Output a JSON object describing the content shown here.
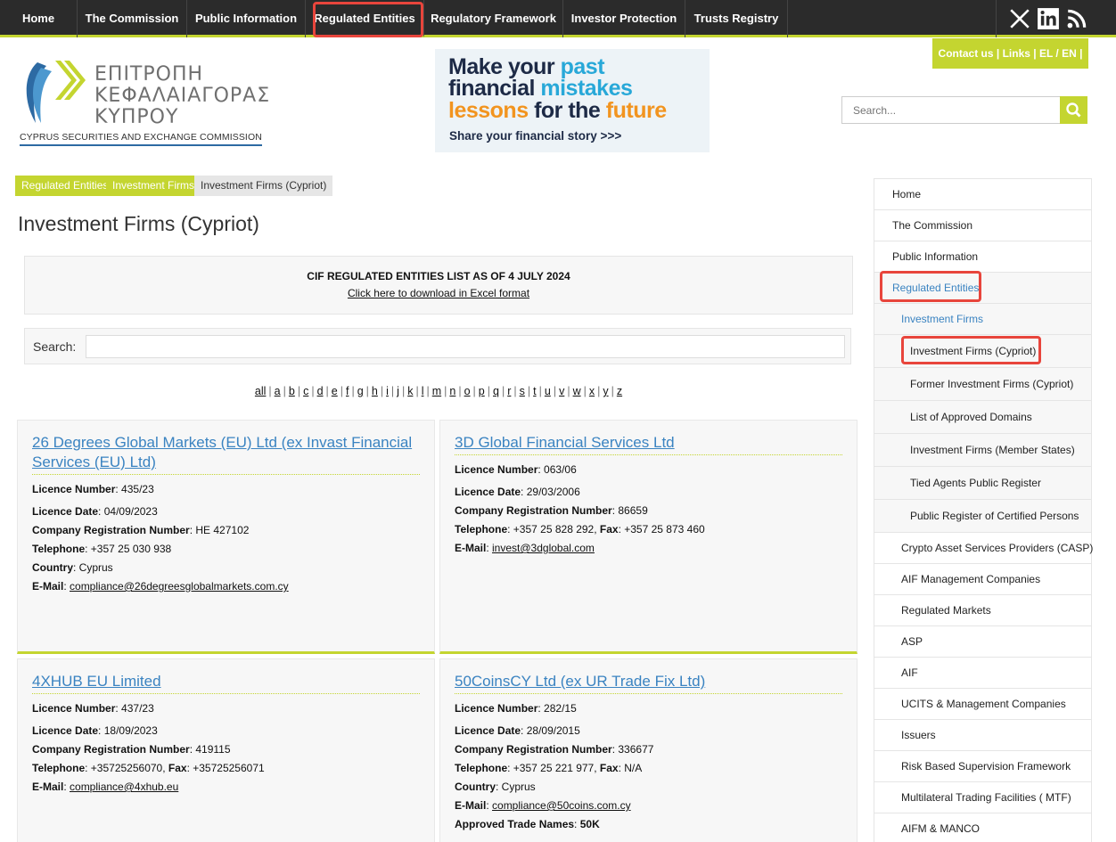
{
  "topnav": {
    "items": [
      "Home",
      "The Commission",
      "Public Information",
      "Regulated Entities",
      "Regulatory Framework",
      "Investor Protection",
      "Trusts Registry"
    ],
    "active_index": 3
  },
  "social": [
    "x-icon",
    "linkedin-icon",
    "rss-icon"
  ],
  "logo": {
    "line1": "ΕΠΙΤΡΟΠΗ",
    "line2": "ΚΕΦΑΛΑΙΑΓΟΡΑΣ",
    "line3": "ΚΥΠΡΟΥ",
    "english": "CYPRUS SECURITIES AND EXCHANGE COMMISSION",
    "colors": {
      "green": "#c4d530",
      "blue": "#2d6aa3",
      "gray": "#6f6f6f"
    }
  },
  "banner": {
    "line1a": "Make your",
    "line1b": "past",
    "line2a": "financial",
    "line2b": "mistakes",
    "line3a": "lessons",
    "line3b": "for the",
    "line3c": "future",
    "sub": "Share your financial story >>>"
  },
  "contact": "Contact us  |  Links  |   EL / EN |",
  "search": {
    "placeholder": "Search..."
  },
  "breadcrumb": [
    "Regulated Entities",
    "Investment Firms",
    "Investment Firms (Cypriot)"
  ],
  "page_title": "Investment Firms (Cypriot)",
  "info": {
    "heading": "CIF REGULATED ENTITIES LIST AS OF 4 JULY 2024",
    "download": "Click here to download in Excel format"
  },
  "list_search_label": "Search:",
  "alphabet": [
    "all",
    "a",
    "b",
    "c",
    "d",
    "e",
    "f",
    "g",
    "h",
    "i",
    "j",
    "k",
    "l",
    "m",
    "n",
    "o",
    "p",
    "q",
    "r",
    "s",
    "t",
    "u",
    "v",
    "w",
    "x",
    "y",
    "z"
  ],
  "labels": {
    "licence_number": "Licence Number",
    "licence_date": "Licence Date",
    "company_reg": "Company Registration Number",
    "telephone": "Telephone",
    "fax": "Fax",
    "country": "Country",
    "email": "E-Mail",
    "approved": "Approved Trade Names"
  },
  "firms": [
    {
      "name": "26 Degrees Global Markets (EU) Ltd (ex Invast Financial Services (EU) Ltd)",
      "licence_number": "435/23",
      "licence_date": "04/09/2023",
      "company_reg": "HE 427102",
      "telephone": "+357 25 030 938",
      "country": "Cyprus",
      "email": "compliance@26degreesglobalmarkets.com.cy"
    },
    {
      "name": "3D Global Financial Services Ltd",
      "licence_number": "063/06",
      "licence_date": "29/03/2006",
      "company_reg": "86659",
      "telephone": "+357 25 828 292",
      "fax": "+357 25 873 460",
      "email": "invest@3dglobal.com"
    },
    {
      "name": "4XHUB EU Limited",
      "licence_number": "437/23",
      "licence_date": "18/09/2023",
      "company_reg": "419115",
      "telephone": "+35725256070",
      "fax": "+35725256071",
      "email": "compliance@4xhub.eu"
    },
    {
      "name": "50CoinsCY Ltd (ex UR Trade Fix Ltd)",
      "licence_number": "282/15",
      "licence_date": "28/09/2015",
      "company_reg": "336677",
      "telephone": "+357 25 221 977",
      "fax": "N/A",
      "country": "Cyprus",
      "email": "compliance@50coins.com.cy",
      "approved": "50K"
    }
  ],
  "sidebar": [
    "Home",
    "The Commission",
    "Public Information",
    "Regulated Entities",
    "Investment Firms",
    "Investment Firms (Cypriot)",
    "Former Investment Firms (Cypriot)",
    "List of Approved Domains",
    "Investment Firms (Member States)",
    "Tied Agents Public Register",
    "Public Register of Certified Persons",
    "Crypto Asset Services Providers (CASP)",
    "AIF Management Companies",
    "Regulated Markets",
    "ASP",
    "AIF",
    "UCITS & Management Companies",
    "Issuers",
    "Risk Based Supervision Framework",
    "Multilateral Trading Facilities ( MTF)",
    "AIFM & MANCO"
  ],
  "colors": {
    "accent": "#c4d530",
    "link": "#3a83c1",
    "nav_bg": "#2b2b2b",
    "highlight": "#e8453c"
  }
}
